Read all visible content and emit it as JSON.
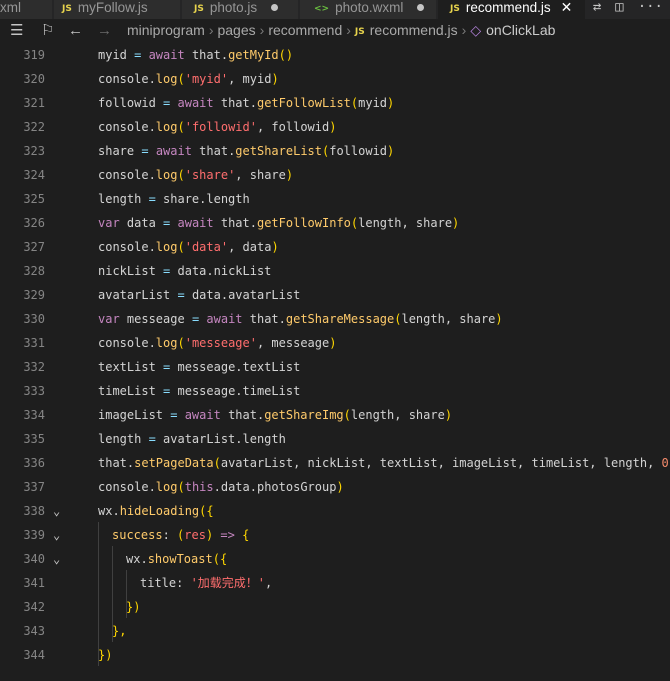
{
  "tabs": [
    {
      "label": "xml",
      "icon": "",
      "state": "",
      "active": false
    },
    {
      "label": "myFollow.js",
      "icon": "JS",
      "state": "",
      "active": false
    },
    {
      "label": "photo.js",
      "icon": "JS",
      "state": "modified",
      "active": false
    },
    {
      "label": "photo.wxml",
      "icon": "<>",
      "state": "modified",
      "active": false
    },
    {
      "label": "recommend.js",
      "icon": "JS",
      "state": "close",
      "active": true
    }
  ],
  "tab_actions": [
    "compare-icon",
    "split-editor-icon",
    "more-icon"
  ],
  "tab_glyphs": {
    "close": "✕",
    "compare": "⇄",
    "split": "◫",
    "more": "···"
  },
  "breadcrumb": {
    "items": [
      "miniprogram",
      "pages",
      "recommend",
      "recommend.js",
      "onClickLab"
    ],
    "file_icon": "JS",
    "symbol_icon": "◇",
    "separator": "›"
  },
  "toolbar_glyphs": {
    "list": "☰",
    "bookmark": "⚐",
    "back": "←",
    "forward": "→"
  },
  "editor": {
    "lines": [
      {
        "num": "319",
        "fold": false,
        "indent": 0,
        "tokens": [
          [
            "v",
            "myid "
          ],
          [
            "o",
            "="
          ],
          [
            "k",
            " await "
          ],
          [
            "v",
            "that."
          ],
          [
            "f",
            "getMyId"
          ],
          [
            "b",
            "()"
          ]
        ]
      },
      {
        "num": "320",
        "fold": false,
        "indent": 0,
        "tokens": [
          [
            "v",
            "console."
          ],
          [
            "f",
            "log"
          ],
          [
            "b",
            "("
          ],
          [
            "s",
            "'myid'"
          ],
          [
            "p",
            ", myid"
          ],
          [
            "b",
            ")"
          ]
        ]
      },
      {
        "num": "321",
        "fold": false,
        "indent": 0,
        "tokens": [
          [
            "v",
            "followid "
          ],
          [
            "o",
            "="
          ],
          [
            "k",
            " await "
          ],
          [
            "v",
            "that."
          ],
          [
            "f",
            "getFollowList"
          ],
          [
            "b",
            "("
          ],
          [
            "v",
            "myid"
          ],
          [
            "b",
            ")"
          ]
        ]
      },
      {
        "num": "322",
        "fold": false,
        "indent": 0,
        "tokens": [
          [
            "v",
            "console."
          ],
          [
            "f",
            "log"
          ],
          [
            "b",
            "("
          ],
          [
            "s",
            "'followid'"
          ],
          [
            "p",
            ", followid"
          ],
          [
            "b",
            ")"
          ]
        ]
      },
      {
        "num": "323",
        "fold": false,
        "indent": 0,
        "tokens": [
          [
            "v",
            "share "
          ],
          [
            "o",
            "="
          ],
          [
            "k",
            " await "
          ],
          [
            "v",
            "that."
          ],
          [
            "f",
            "getShareList"
          ],
          [
            "b",
            "("
          ],
          [
            "v",
            "followid"
          ],
          [
            "b",
            ")"
          ]
        ]
      },
      {
        "num": "324",
        "fold": false,
        "indent": 0,
        "tokens": [
          [
            "v",
            "console."
          ],
          [
            "f",
            "log"
          ],
          [
            "b",
            "("
          ],
          [
            "s",
            "'share'"
          ],
          [
            "p",
            ", share"
          ],
          [
            "b",
            ")"
          ]
        ]
      },
      {
        "num": "325",
        "fold": false,
        "indent": 0,
        "tokens": [
          [
            "v",
            "length "
          ],
          [
            "o",
            "="
          ],
          [
            "v",
            " share.length"
          ]
        ]
      },
      {
        "num": "326",
        "fold": false,
        "indent": 0,
        "tokens": [
          [
            "k",
            "var "
          ],
          [
            "v",
            "data "
          ],
          [
            "o",
            "="
          ],
          [
            "k",
            " await "
          ],
          [
            "v",
            "that."
          ],
          [
            "f",
            "getFollowInfo"
          ],
          [
            "b",
            "("
          ],
          [
            "v",
            "length, share"
          ],
          [
            "b",
            ")"
          ]
        ]
      },
      {
        "num": "327",
        "fold": false,
        "indent": 0,
        "tokens": [
          [
            "v",
            "console."
          ],
          [
            "f",
            "log"
          ],
          [
            "b",
            "("
          ],
          [
            "s",
            "'data'"
          ],
          [
            "p",
            ", data"
          ],
          [
            "b",
            ")"
          ]
        ]
      },
      {
        "num": "328",
        "fold": false,
        "indent": 0,
        "tokens": [
          [
            "v",
            "nickList "
          ],
          [
            "o",
            "="
          ],
          [
            "v",
            " data.nickList"
          ]
        ]
      },
      {
        "num": "329",
        "fold": false,
        "indent": 0,
        "tokens": [
          [
            "v",
            "avatarList "
          ],
          [
            "o",
            "="
          ],
          [
            "v",
            " data.avatarList"
          ]
        ]
      },
      {
        "num": "330",
        "fold": false,
        "indent": 0,
        "tokens": [
          [
            "k",
            "var "
          ],
          [
            "v",
            "messeage "
          ],
          [
            "o",
            "="
          ],
          [
            "k",
            " await "
          ],
          [
            "v",
            "that."
          ],
          [
            "f",
            "getShareMessage"
          ],
          [
            "b",
            "("
          ],
          [
            "v",
            "length, share"
          ],
          [
            "b",
            ")"
          ]
        ]
      },
      {
        "num": "331",
        "fold": false,
        "indent": 0,
        "tokens": [
          [
            "v",
            "console."
          ],
          [
            "f",
            "log"
          ],
          [
            "b",
            "("
          ],
          [
            "s",
            "'messeage'"
          ],
          [
            "p",
            ", messeage"
          ],
          [
            "b",
            ")"
          ]
        ]
      },
      {
        "num": "332",
        "fold": false,
        "indent": 0,
        "tokens": [
          [
            "v",
            "textList "
          ],
          [
            "o",
            "="
          ],
          [
            "v",
            " messeage.textList"
          ]
        ]
      },
      {
        "num": "333",
        "fold": false,
        "indent": 0,
        "tokens": [
          [
            "v",
            "timeList "
          ],
          [
            "o",
            "="
          ],
          [
            "v",
            " messeage.timeList"
          ]
        ]
      },
      {
        "num": "334",
        "fold": false,
        "indent": 0,
        "tokens": [
          [
            "v",
            "imageList "
          ],
          [
            "o",
            "="
          ],
          [
            "k",
            " await "
          ],
          [
            "v",
            "that."
          ],
          [
            "f",
            "getShareImg"
          ],
          [
            "b",
            "("
          ],
          [
            "v",
            "length, share"
          ],
          [
            "b",
            ")"
          ]
        ]
      },
      {
        "num": "335",
        "fold": false,
        "indent": 0,
        "tokens": [
          [
            "v",
            "length "
          ],
          [
            "o",
            "="
          ],
          [
            "v",
            " avatarList.length"
          ]
        ]
      },
      {
        "num": "336",
        "fold": false,
        "indent": 0,
        "tokens": [
          [
            "v",
            "that."
          ],
          [
            "f",
            "setPageData"
          ],
          [
            "b",
            "("
          ],
          [
            "v",
            "avatarList, nickList, textList, imageList, timeList, length, "
          ],
          [
            "n",
            "0"
          ],
          [
            "b",
            ")"
          ]
        ]
      },
      {
        "num": "337",
        "fold": false,
        "indent": 0,
        "tokens": [
          [
            "v",
            "console."
          ],
          [
            "f",
            "log"
          ],
          [
            "b",
            "("
          ],
          [
            "k",
            "this"
          ],
          [
            "v",
            ".data.photosGroup"
          ],
          [
            "b",
            ")"
          ]
        ]
      },
      {
        "num": "338",
        "fold": true,
        "indent": 0,
        "tokens": [
          [
            "v",
            "wx."
          ],
          [
            "f",
            "hideLoading"
          ],
          [
            "b",
            "({"
          ]
        ]
      },
      {
        "num": "339",
        "fold": true,
        "indent": 1,
        "tokens": [
          [
            "f",
            "success"
          ],
          [
            "p",
            ": "
          ],
          [
            "b",
            "("
          ],
          [
            "s",
            "res"
          ],
          [
            "b",
            ")"
          ],
          [
            "k",
            " => "
          ],
          [
            "b",
            "{"
          ]
        ]
      },
      {
        "num": "340",
        "fold": true,
        "indent": 2,
        "tokens": [
          [
            "v",
            "wx."
          ],
          [
            "f",
            "showToast"
          ],
          [
            "b",
            "({"
          ]
        ]
      },
      {
        "num": "341",
        "fold": false,
        "indent": 3,
        "tokens": [
          [
            "v",
            "title"
          ],
          [
            "p",
            ": "
          ],
          [
            "s",
            "'加载完成！'"
          ],
          [
            "p",
            ","
          ]
        ]
      },
      {
        "num": "342",
        "fold": false,
        "indent": 2,
        "tokens": [
          [
            "b",
            "})"
          ]
        ]
      },
      {
        "num": "343",
        "fold": false,
        "indent": 1,
        "tokens": [
          [
            "b",
            "},"
          ]
        ]
      },
      {
        "num": "344",
        "fold": false,
        "indent": 0,
        "tokens": [
          [
            "b",
            "})"
          ]
        ]
      }
    ],
    "fold_glyph": "⌄"
  }
}
